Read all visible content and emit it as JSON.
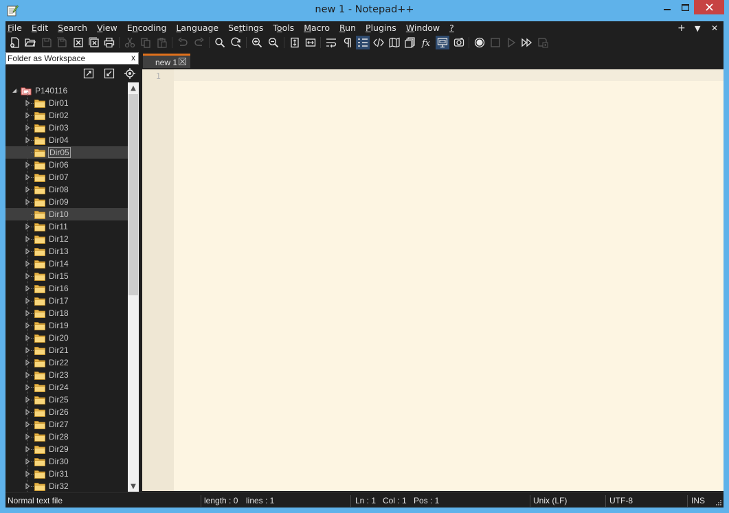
{
  "window": {
    "title": "new 1 - Notepad++",
    "controls": {
      "minimize": "—",
      "maximize": "☐",
      "close": "✕"
    }
  },
  "menu": {
    "items": [
      {
        "pre": "",
        "u": "F",
        "post": "ile"
      },
      {
        "pre": "",
        "u": "E",
        "post": "dit"
      },
      {
        "pre": "",
        "u": "S",
        "post": "earch"
      },
      {
        "pre": "",
        "u": "V",
        "post": "iew"
      },
      {
        "pre": "E",
        "u": "n",
        "post": "coding"
      },
      {
        "pre": "",
        "u": "L",
        "post": "anguage"
      },
      {
        "pre": "Se",
        "u": "t",
        "post": "tings"
      },
      {
        "pre": "T",
        "u": "o",
        "post": "ols"
      },
      {
        "pre": "",
        "u": "M",
        "post": "acro"
      },
      {
        "pre": "",
        "u": "R",
        "post": "un"
      },
      {
        "pre": "",
        "u": "P",
        "post": "lugins"
      },
      {
        "pre": "",
        "u": "W",
        "post": "indow"
      },
      {
        "pre": "",
        "u": "?",
        "post": ""
      }
    ],
    "right": {
      "plus": "+",
      "down": "▼",
      "close": "✕"
    }
  },
  "toolbar": {
    "icons": [
      "new-file",
      "open-file",
      "save",
      "save-all",
      "close",
      "close-all",
      "print",
      "cut",
      "copy",
      "paste",
      "undo",
      "redo",
      "find",
      "replace",
      "zoom-in",
      "zoom-out",
      "sync-vertical",
      "sync-horizontal",
      "word-wrap",
      "show-all-chars",
      "indent-guide",
      "udl",
      "document-map",
      "document-list",
      "function-list",
      "folder-as-workspace",
      "monitoring",
      "macro-record",
      "macro-stop",
      "macro-play",
      "macro-run-multiple",
      "macro-save"
    ]
  },
  "panel": {
    "title": "Folder as Workspace",
    "close": "x",
    "root": "P140116",
    "folders": [
      "Dir01",
      "Dir02",
      "Dir03",
      "Dir04",
      "Dir05",
      "Dir06",
      "Dir07",
      "Dir08",
      "Dir09",
      "Dir10",
      "Dir11",
      "Dir12",
      "Dir13",
      "Dir14",
      "Dir15",
      "Dir16",
      "Dir17",
      "Dir18",
      "Dir19",
      "Dir20",
      "Dir21",
      "Dir22",
      "Dir23",
      "Dir24",
      "Dir25",
      "Dir26",
      "Dir27",
      "Dir28",
      "Dir29",
      "Dir30",
      "Dir31",
      "Dir32"
    ],
    "selected": [
      "Dir05",
      "Dir10"
    ],
    "scroll_up": "▲",
    "scroll_down": "▼"
  },
  "editor": {
    "tab_label": "new 1",
    "line_number": "1"
  },
  "status": {
    "filetype": "Normal text file",
    "length": "length : 0",
    "lines": "lines : 1",
    "ln": "Ln : 1",
    "col": "Col : 1",
    "pos": "Pos : 1",
    "eol": "Unix (LF)",
    "encoding": "UTF-8",
    "mode": "INS"
  },
  "colors": {
    "title_bar": "#5fb2ea",
    "ui_dark": "#1f1f1f",
    "editor_bg": "#fdf5e2",
    "tab_accent": "#e0711c",
    "close_button": "#c74343"
  }
}
